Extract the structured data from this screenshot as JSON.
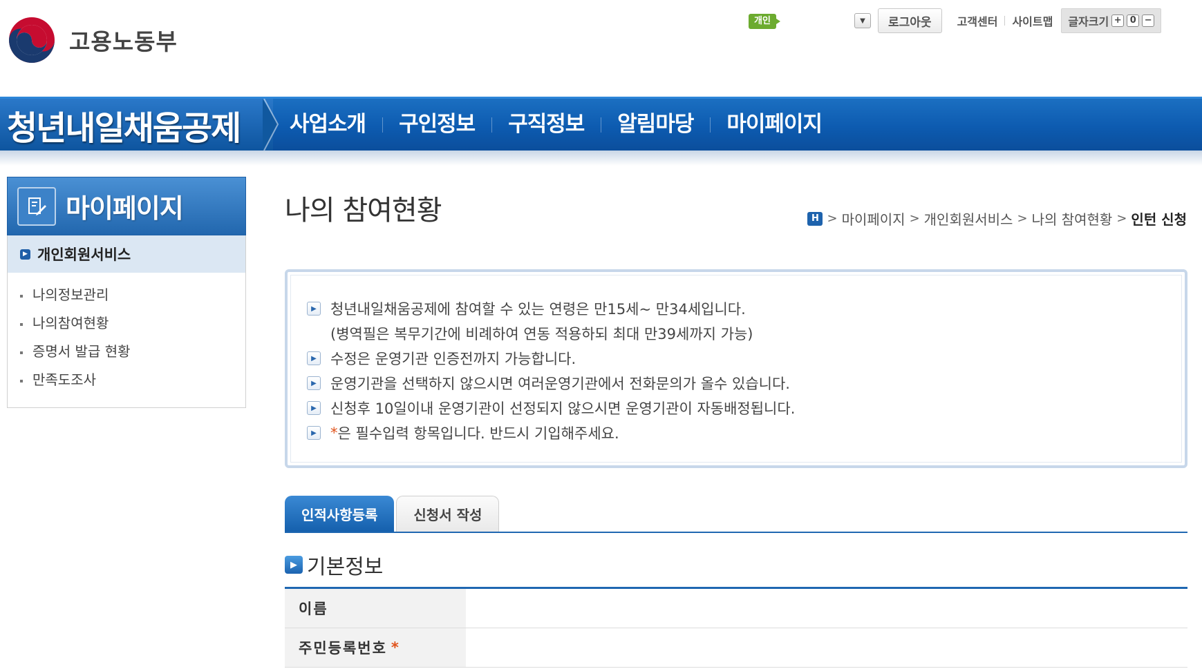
{
  "header": {
    "ministry_name": "고용노동부",
    "badge": "개인",
    "logout": "로그아웃",
    "customer_center": "고객센터",
    "sitemap": "사이트맵",
    "font_size_label": "글자크기",
    "font_size_buttons": [
      "+",
      "0",
      "−"
    ]
  },
  "nav": {
    "brand": "청년내일채움공제",
    "items": [
      "사업소개",
      "구인정보",
      "구직정보",
      "알림마당",
      "마이페이지"
    ]
  },
  "sidebar": {
    "title": "마이페이지",
    "subtitle": "개인회원서비스",
    "items": [
      "나의정보관리",
      "나의참여현황",
      "증명서 발급 현황",
      "만족도조사"
    ]
  },
  "main": {
    "page_title": "나의 참여현황",
    "breadcrumb": {
      "home": "H",
      "items": [
        "마이페이지",
        "개인회원서비스",
        "나의 참여현황"
      ],
      "current": "인턴 신청"
    },
    "notices": [
      "청년내일채움공제에 참여할 수 있는 연령은 만15세~ 만34세입니다.",
      "(병역필은 복무기간에 비례하여 연동 적용하되 최대 만39세까지 가능)",
      "수정은 운영기관 인증전까지 가능합니다.",
      "운영기관을 선택하지 않으시면 여러운영기관에서 전화문의가 올수 있습니다.",
      "신청후 10일이내 운영기관이 선정되지 않으시면 운영기관이 자동배정됩니다.",
      "은 필수입력 항목입니다. 반드시 기입해주세요."
    ],
    "required_mark": "*",
    "tabs": [
      "인적사항등록",
      "신청서 작성"
    ],
    "section_title": "기본정보",
    "form": {
      "name_label": "이름",
      "rrn_label": "주민등록번호"
    }
  },
  "colors": {
    "primary": "#0d5bb0",
    "accent": "#1f67b1",
    "badge": "#6cab2f",
    "required": "#e0531c"
  }
}
